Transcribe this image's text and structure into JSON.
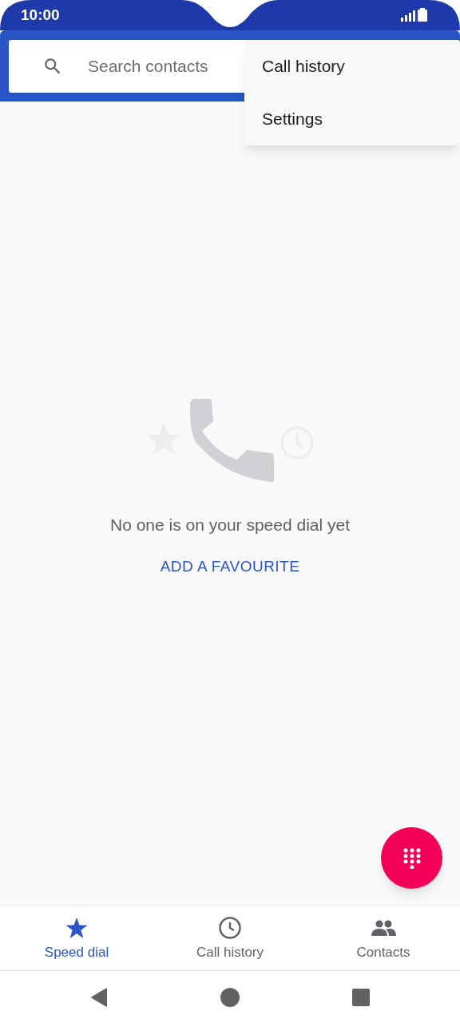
{
  "status_bar": {
    "time": "10:00"
  },
  "search": {
    "placeholder": "Search contacts"
  },
  "menu": [
    {
      "label": "Call history"
    },
    {
      "label": "Settings"
    }
  ],
  "empty_state": {
    "message": "No one is on your speed dial yet",
    "action": "ADD A FAVOURITE"
  },
  "tabs": [
    {
      "label": "Speed dial",
      "selected": true
    },
    {
      "label": "Call history",
      "selected": false
    },
    {
      "label": "Contacts",
      "selected": false
    }
  ]
}
